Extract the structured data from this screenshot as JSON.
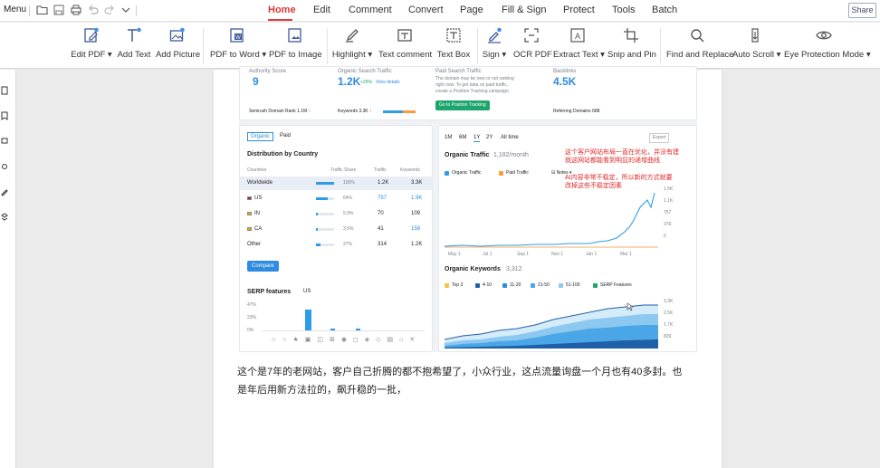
{
  "menubar": {
    "menu_label": "Menu",
    "tabs": [
      {
        "label": "Home",
        "active": true
      },
      {
        "label": "Edit"
      },
      {
        "label": "Comment"
      },
      {
        "label": "Convert"
      },
      {
        "label": "Page"
      },
      {
        "label": "Fill & Sign"
      },
      {
        "label": "Protect"
      },
      {
        "label": "Tools"
      },
      {
        "label": "Batch"
      }
    ],
    "share_label": "Share",
    "accent_color": "#d93a3a"
  },
  "ribbon": {
    "tools": [
      {
        "label": "Edit PDF ▾",
        "icon": "edit-pdf-icon"
      },
      {
        "label": "Add Text",
        "icon": "add-text-icon"
      },
      {
        "label": "Add Picture",
        "icon": "add-picture-icon"
      },
      {
        "label": "PDF to Word ▾",
        "icon": "pdf-to-word-icon"
      },
      {
        "label": "PDF to Image",
        "icon": "pdf-to-image-icon"
      },
      {
        "label": "Highlight ▾",
        "icon": "highlight-icon"
      },
      {
        "label": "Text comment",
        "icon": "text-comment-icon"
      },
      {
        "label": "Text Box",
        "icon": "text-box-icon"
      },
      {
        "label": "Sign ▾",
        "icon": "sign-icon"
      },
      {
        "label": "OCR PDF",
        "icon": "ocr-icon"
      },
      {
        "label": "Extract Text ▾",
        "icon": "extract-text-icon"
      },
      {
        "label": "Snip and Pin",
        "icon": "snip-pin-icon"
      },
      {
        "label": "Find and Replace",
        "icon": "search-icon"
      },
      {
        "label": "Auto Scroll ▾",
        "icon": "auto-scroll-icon"
      },
      {
        "label": "Eye Protection Mode ▾",
        "icon": "eye-icon"
      }
    ]
  },
  "document": {
    "screenshot": {
      "stats": {
        "authority_label": "Authority Score",
        "authority_value": "9",
        "semrush_rank": "Semrush Domain Rank 1.1M ↑",
        "organic_search_label": "Organic Search Traffic",
        "organic_search_value": "1.2K",
        "organic_search_change": "+26%",
        "view_details": "View details",
        "keywords_line": "Keywords 3.3K ↑",
        "paid_label": "Paid Search Traffic",
        "paid_text_1": "The domain may be new or not ranking",
        "paid_text_2": "right now. To get data on paid traffic,",
        "paid_text_3": "create a Position Tracking campaign.",
        "paid_button": "Go to Position Tracking",
        "backlinks_label": "Backlinks",
        "backlinks_value": "4.5K",
        "referring_domains": "Referring Domains 688"
      },
      "toggle": {
        "organic": "Organic",
        "paid": "Paid"
      },
      "distribution": {
        "title": "Distribution by Country",
        "headers": [
          "Countries",
          "Traffic Share",
          "Traffic",
          "Keywords"
        ],
        "rows": [
          {
            "country": "Worldwide",
            "share": "100%",
            "share_value": 100,
            "traffic": "1.2K",
            "keywords": "3.3K"
          },
          {
            "country": "US",
            "share": "64%",
            "share_value": 64,
            "traffic": "757",
            "keywords": "1.9K"
          },
          {
            "country": "IN",
            "share": "5.9%",
            "share_value": 5.9,
            "traffic": "70",
            "keywords": "109"
          },
          {
            "country": "CA",
            "share": "3.5%",
            "share_value": 3.5,
            "traffic": "41",
            "keywords": "158"
          },
          {
            "country": "Other",
            "share": "27%",
            "share_value": 27,
            "traffic": "314",
            "keywords": "1.2K"
          }
        ],
        "compare_button": "Compare"
      },
      "serp": {
        "title": "SERP features",
        "country": "US",
        "ticks": [
          "47%",
          "23%",
          "0%"
        ]
      },
      "periods": [
        "1M",
        "6M",
        "1Y",
        "2Y",
        "All time"
      ],
      "active_period": "1Y",
      "export_label": "Export",
      "organic_traffic": {
        "title": "Organic Traffic",
        "value": "1,182/month",
        "legend": [
          "Organic Traffic",
          "Paid Traffic",
          "Notes"
        ],
        "y_ticks": [
          "1.5K",
          "1.1K",
          "757",
          "379",
          "0"
        ],
        "x_ticks": [
          "May 1",
          "Jul 1",
          "Sep 1",
          "Nov 1",
          "Jan 1",
          "Mar 1"
        ]
      },
      "organic_keywords": {
        "title": "Organic Keywords",
        "value": "3,312",
        "legend": [
          "Top 3",
          "4-10",
          "11-20",
          "21-50",
          "51-100",
          "SERP Features"
        ],
        "y_ticks": [
          "3.3K",
          "2.5K",
          "1.7K",
          "829"
        ]
      },
      "annotation_1": "这个客户网站布局一直在优化，并没有建",
      "annotation_2": "就这网站都能看到明显的递增曲线",
      "annotation_3": "AI内容非常不稳定，所以新的方式就要",
      "annotation_4": "改掉这些不稳定因素"
    },
    "paragraph_line_1": "这个是7年的老网站，客户自己折腾的都不抱希望了，小众行业，这点流量询盘一个月也有40多封。也",
    "paragraph_line_2": "是年后用新方法拉的，飙升稳的一批，"
  }
}
